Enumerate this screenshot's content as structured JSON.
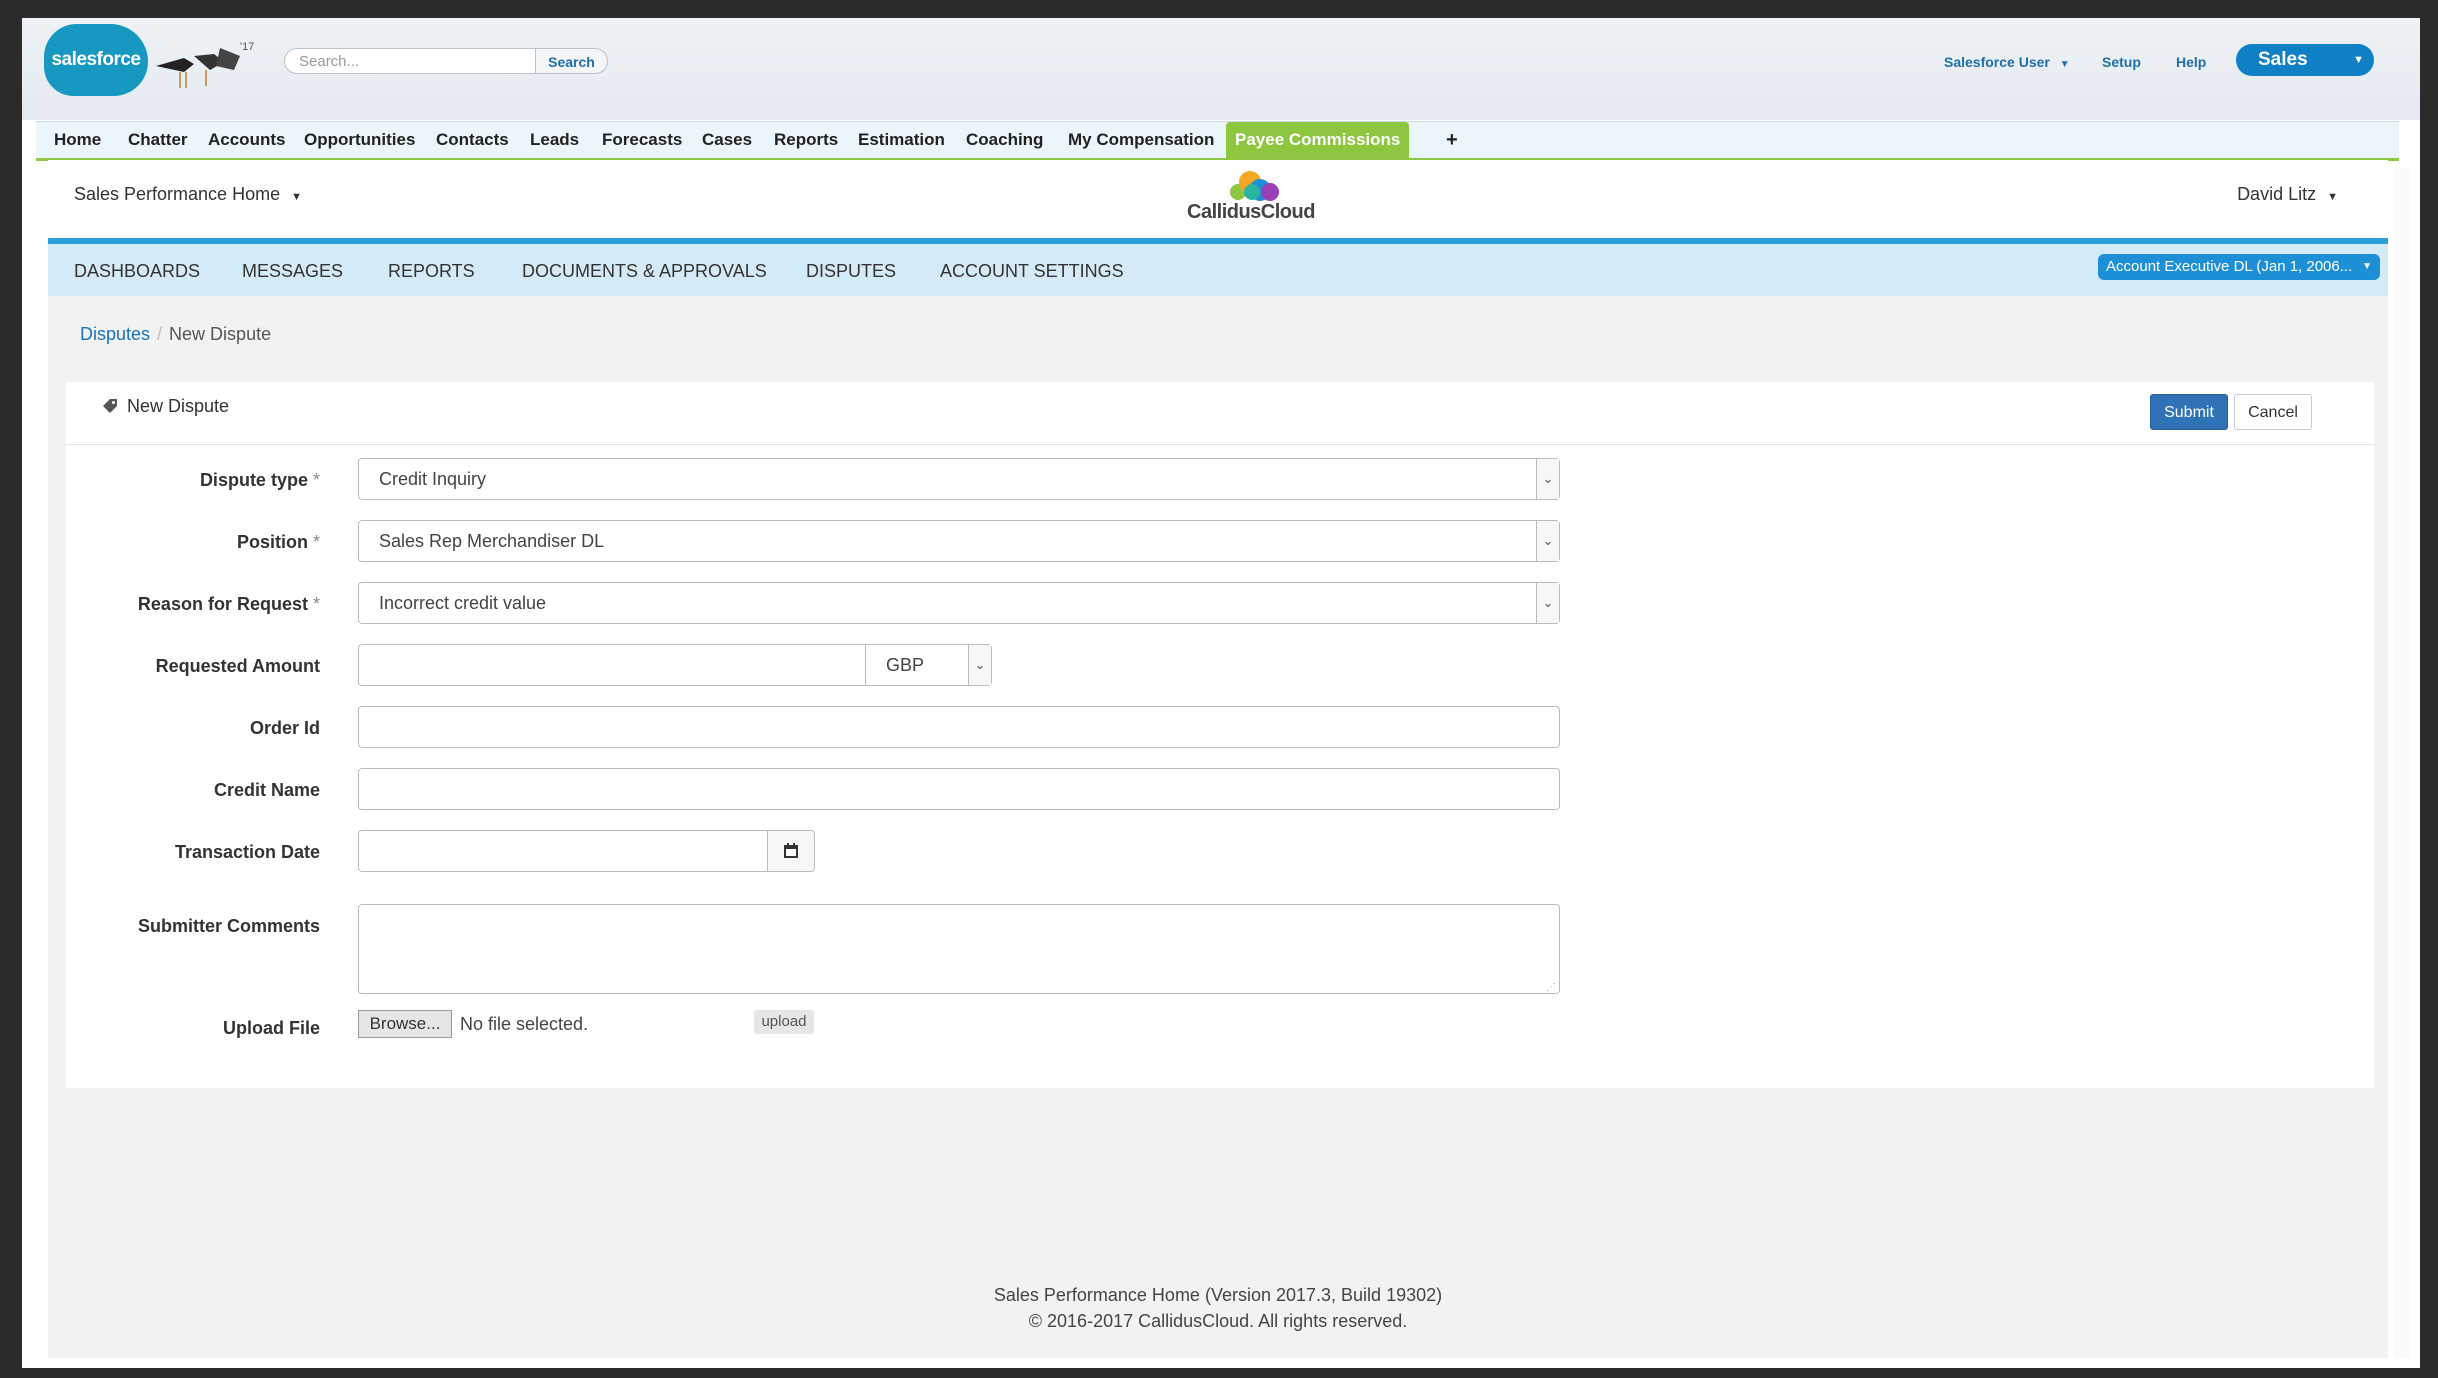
{
  "header": {
    "logo_text": "salesforce",
    "search_placeholder": "Search...",
    "search_button": "Search",
    "user_menu": "Salesforce User",
    "setup": "Setup",
    "help": "Help",
    "app_switcher": "Sales"
  },
  "tabs": [
    {
      "label": "Home"
    },
    {
      "label": "Chatter"
    },
    {
      "label": "Accounts"
    },
    {
      "label": "Opportunities"
    },
    {
      "label": "Contacts"
    },
    {
      "label": "Leads"
    },
    {
      "label": "Forecasts"
    },
    {
      "label": "Cases"
    },
    {
      "label": "Reports"
    },
    {
      "label": "Estimation"
    },
    {
      "label": "Coaching"
    },
    {
      "label": "My Compensation"
    },
    {
      "label": "Payee Commissions"
    }
  ],
  "add_tab": "+",
  "app": {
    "home_menu": "Sales Performance Home",
    "logo_text": "CallidusCloud",
    "user_name": "David Litz",
    "subnav": [
      "DASHBOARDS",
      "MESSAGES",
      "REPORTS",
      "DOCUMENTS & APPROVALS",
      "DISPUTES",
      "ACCOUNT SETTINGS"
    ],
    "position_selector": "Account Executive DL (Jan 1, 2006..."
  },
  "breadcrumb": {
    "parent": "Disputes",
    "current": "New Dispute"
  },
  "form": {
    "title": "New Dispute",
    "submit": "Submit",
    "cancel": "Cancel",
    "required_marker": "*",
    "dispute_type": {
      "label": "Dispute type",
      "value": "Credit Inquiry"
    },
    "position": {
      "label": "Position",
      "value": "Sales Rep Merchandiser DL"
    },
    "reason": {
      "label": "Reason for Request",
      "value": "Incorrect credit value"
    },
    "requested_amount": {
      "label": "Requested Amount",
      "value": "",
      "currency": "GBP"
    },
    "order_id": {
      "label": "Order Id",
      "value": ""
    },
    "credit_name": {
      "label": "Credit Name",
      "value": ""
    },
    "transaction_date": {
      "label": "Transaction Date",
      "value": ""
    },
    "comments": {
      "label": "Submitter Comments",
      "value": ""
    },
    "upload": {
      "label": "Upload File",
      "browse": "Browse...",
      "status": "No file selected.",
      "button": "upload"
    }
  },
  "footer": {
    "line1": "Sales Performance Home (Version 2017.3, Build 19302)",
    "line2": "© 2016-2017 CallidusCloud. All rights reserved."
  },
  "colors": {
    "salesforce_blue": "#1798c1",
    "active_tab_green": "#8dc63f",
    "submit_blue": "#2f73b6",
    "subnav_bg": "#d4ebf7"
  }
}
